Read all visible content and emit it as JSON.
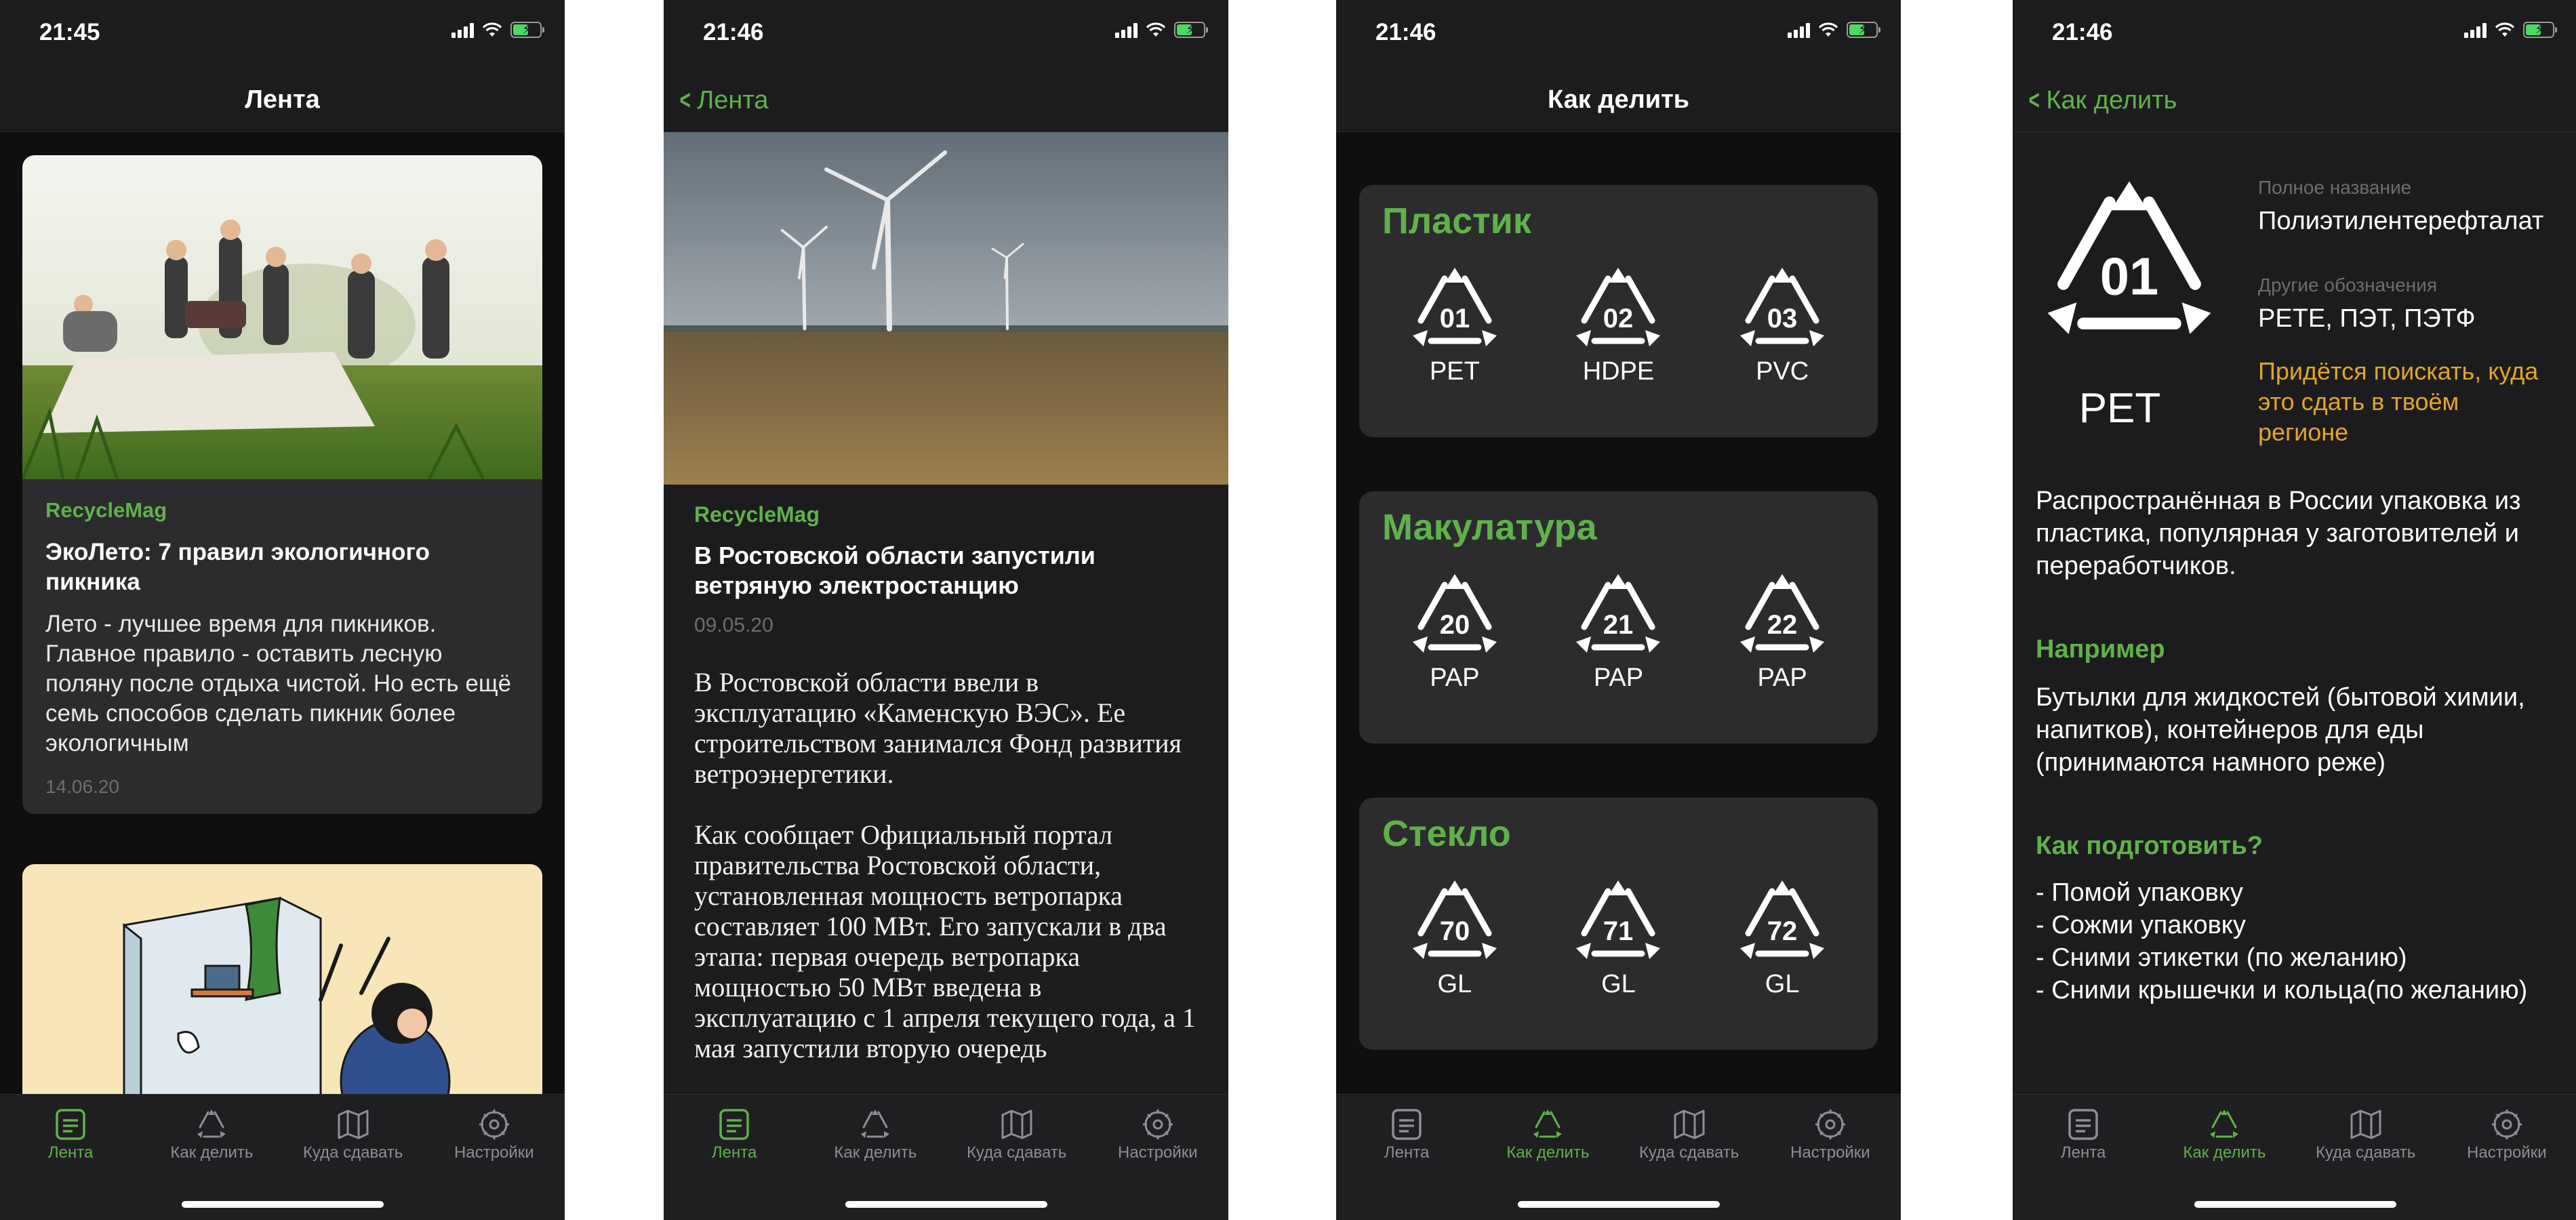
{
  "accent": "#5fb24a",
  "warning_color": "#e2a52a",
  "tabbar": {
    "items": [
      {
        "label": "Лента",
        "icon": "feed-icon"
      },
      {
        "label": "Как делить",
        "icon": "recycle-icon"
      },
      {
        "label": "Куда сдавать",
        "icon": "map-icon"
      },
      {
        "label": "Настройки",
        "icon": "gear-icon"
      }
    ]
  },
  "screen1": {
    "time": "21:45",
    "title": "Лента",
    "card1": {
      "source": "RecycleMag",
      "title": "ЭкоЛето: 7 правил экологичного пикника",
      "text": "Лето - лучшее время для пикников. Главное правило - оставить лесную поляну после отдыха чистой. Но есть ещё семь способов сделать пикник более экологичным",
      "date": "14.06.20"
    }
  },
  "screen2": {
    "time": "21:46",
    "back": "Лента",
    "source": "RecycleMag",
    "title": "В Ростовской области запустили ветряную электростанцию",
    "date": "09.05.20",
    "text": "В Ростовской области ввели в эксплуатацию «Каменскую ВЭС». Ее строительством занимался Фонд развития ветроэнергетики.\n\nКак сообщает Официальный портал правительства Ростовской области, установленная мощность ветропарка составляет 100 МВт. Его запускали в два этапа: первая очередь ветропарка мощностью 50 МВт введена в эксплуатацию с 1 апреля текущего года, а 1 мая запустили вторую очередь"
  },
  "screen3": {
    "time": "21:46",
    "title": "Как делить",
    "categories": [
      {
        "name": "Пластик",
        "codes": [
          {
            "num": "01",
            "label": "PET"
          },
          {
            "num": "02",
            "label": "HDPE"
          },
          {
            "num": "03",
            "label": "PVC"
          }
        ]
      },
      {
        "name": "Макулатура",
        "codes": [
          {
            "num": "20",
            "label": "PAP"
          },
          {
            "num": "21",
            "label": "PAP"
          },
          {
            "num": "22",
            "label": "PAP"
          }
        ]
      },
      {
        "name": "Стекло",
        "codes": [
          {
            "num": "70",
            "label": "GL"
          },
          {
            "num": "71",
            "label": "GL"
          },
          {
            "num": "72",
            "label": "GL"
          }
        ]
      }
    ]
  },
  "screen4": {
    "time": "21:46",
    "back": "Как делить",
    "code_num": "01",
    "code_label": "PET",
    "full_name_label": "Полное название",
    "full_name": "Полиэтилентерефталат",
    "other_label": "Другие обозначения",
    "other": "PETE, ПЭТ, ПЭТФ",
    "warning": "Придётся поискать, куда это сдать в твоём регионе",
    "description": "Распространённая в России упаковка из пластика, популярная у заготовителей и переработчиков.",
    "example_head": "Например",
    "example_text": "Бутылки для жидкостей (бытовой химии, напитков), контейнеров для еды (принимаются намного реже)",
    "prep_head": "Как подготовить?",
    "prep_text": "- Помой упаковку\n- Сожми упаковку\n- Сними этикетки (по желанию)\n- Сними крышечки и кольца(по желанию)"
  }
}
